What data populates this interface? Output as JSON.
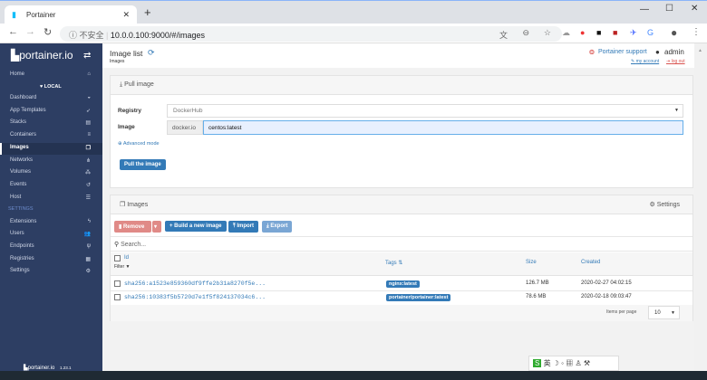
{
  "browser": {
    "tab_title": "Portainer",
    "new_tab": "+",
    "security": "不安全",
    "url": "10.0.0.100:9000/#/images"
  },
  "sidebar": {
    "logo": "portainer.io",
    "endpoint": "LOCAL",
    "settings_header": "SETTINGS",
    "version": "1.23.1",
    "items": [
      {
        "label": "Home",
        "icon": "home-icon"
      },
      {
        "label": "Dashboard",
        "icon": "tachometer-icon"
      },
      {
        "label": "App Templates",
        "icon": "rocket-icon"
      },
      {
        "label": "Stacks",
        "icon": "th-list-icon"
      },
      {
        "label": "Containers",
        "icon": "server-icon"
      },
      {
        "label": "Images",
        "icon": "clone-icon"
      },
      {
        "label": "Networks",
        "icon": "sitemap-icon"
      },
      {
        "label": "Volumes",
        "icon": "cubes-icon"
      },
      {
        "label": "Events",
        "icon": "history-icon"
      },
      {
        "label": "Host",
        "icon": "th-icon"
      }
    ],
    "settings_items": [
      {
        "label": "Extensions",
        "icon": "bolt-icon"
      },
      {
        "label": "Users",
        "icon": "users-icon"
      },
      {
        "label": "Endpoints",
        "icon": "plug-icon"
      },
      {
        "label": "Registries",
        "icon": "database-icon"
      },
      {
        "label": "Settings",
        "icon": "cogs-icon"
      }
    ]
  },
  "header": {
    "title": "Image list",
    "breadcrumb": "Images",
    "support": "Portainer support",
    "user": "admin",
    "my_account": "my account",
    "log_out": "log out"
  },
  "pull": {
    "title": "Pull image",
    "registry_label": "Registry",
    "registry_value": "DockerHub",
    "image_label": "Image",
    "image_prefix": "docker.io",
    "image_value": "centos:latest",
    "advanced": "Advanced mode",
    "pull_button": "Pull the image"
  },
  "images": {
    "title": "Images",
    "settings": "Settings",
    "remove": "Remove",
    "build": "Build a new image",
    "import": "Import",
    "export": "Export",
    "search_placeholder": "Search...",
    "columns": {
      "id": "Id",
      "filter": "Filter",
      "tags": "Tags",
      "size": "Size",
      "created": "Created"
    },
    "rows": [
      {
        "id": "sha256:a1523e859360df9ffe2b31a8270f5e...",
        "tag": "nginx:latest",
        "size": "126.7 MB",
        "created": "2020-02-27 04:02:15"
      },
      {
        "id": "sha256:10383f5b5720d7e1f5f824137034c6...",
        "tag": "portainer/portainer:latest",
        "size": "78.6 MB",
        "created": "2020-02-18 09:03:47"
      }
    ],
    "items_per_page_label": "Items per page",
    "items_per_page": "10"
  },
  "colors": {
    "sidebar": "#2d3e63",
    "primary": "#337ab7",
    "danger": "#d9534f"
  }
}
